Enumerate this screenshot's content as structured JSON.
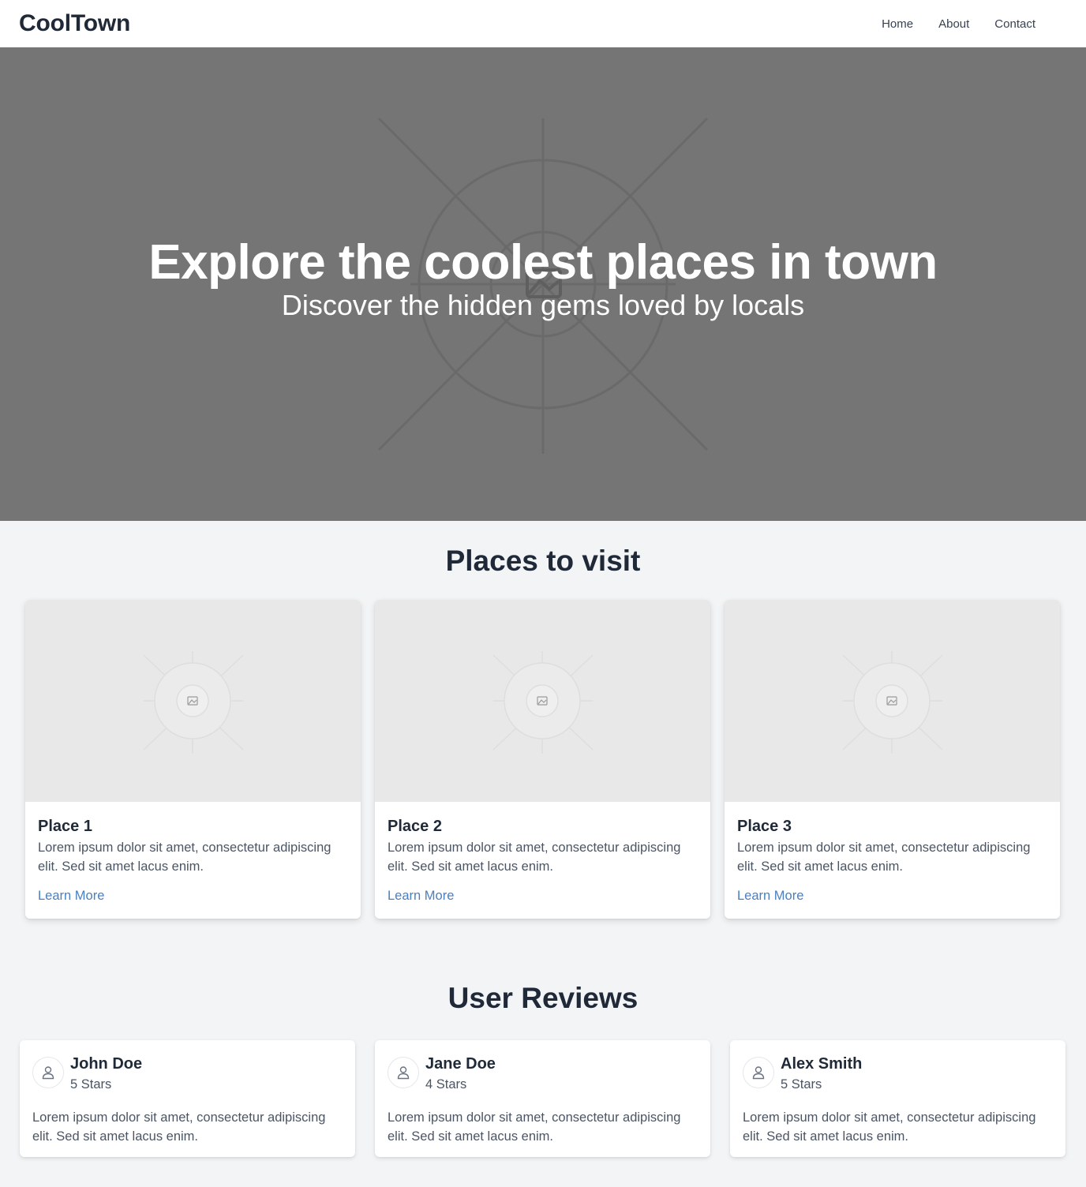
{
  "header": {
    "brand": "CoolTown",
    "nav": [
      {
        "label": "Home"
      },
      {
        "label": "About"
      },
      {
        "label": "Contact"
      }
    ]
  },
  "hero": {
    "title": "Explore the coolest places in town",
    "subtitle": "Discover the hidden gems loved by locals",
    "background_color": "#757575"
  },
  "places": {
    "title": "Places to visit",
    "items": [
      {
        "name": "Place 1",
        "description": "Lorem ipsum dolor sit amet, consectetur adipiscing elit. Sed sit amet lacus enim.",
        "link": "Learn More"
      },
      {
        "name": "Place 2",
        "description": "Lorem ipsum dolor sit amet, consectetur adipiscing elit. Sed sit amet lacus enim.",
        "link": "Learn More"
      },
      {
        "name": "Place 3",
        "description": "Lorem ipsum dolor sit amet, consectetur adipiscing elit. Sed sit amet lacus enim.",
        "link": "Learn More"
      }
    ]
  },
  "reviews": {
    "title": "User Reviews",
    "items": [
      {
        "name": "John Doe",
        "rating": "5 Stars",
        "text": "Lorem ipsum dolor sit amet, consectetur adipiscing elit. Sed sit amet lacus enim."
      },
      {
        "name": "Jane Doe",
        "rating": "4 Stars",
        "text": "Lorem ipsum dolor sit amet, consectetur adipiscing elit. Sed sit amet lacus enim."
      },
      {
        "name": "Alex Smith",
        "rating": "5 Stars",
        "text": "Lorem ipsum dolor sit amet, consectetur adipiscing elit. Sed sit amet lacus enim."
      }
    ]
  },
  "colors": {
    "link": "#4a7fc1",
    "page_background": "#f2f4f6",
    "text_dark": "#1f2937"
  },
  "icons": {
    "image_placeholder": "image-placeholder-icon",
    "avatar": "user-icon"
  }
}
